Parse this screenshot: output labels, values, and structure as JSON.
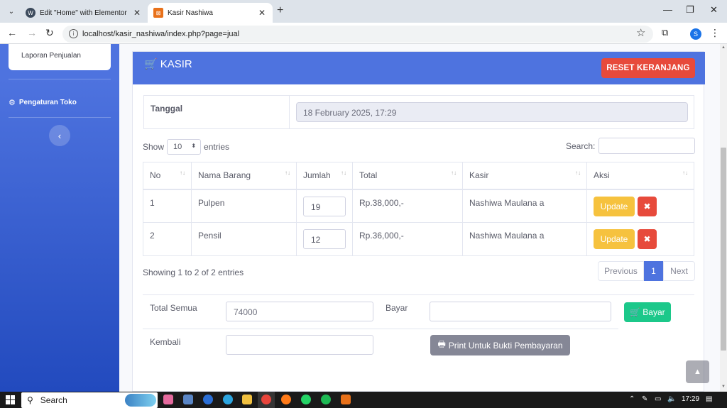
{
  "browser": {
    "tabs": [
      {
        "title": "Edit \"Home\" with Elementor",
        "icon": "wordpress-icon"
      },
      {
        "title": "Kasir Nashiwa",
        "icon": "xampp-icon"
      }
    ],
    "url": "localhost/kasir_nashiwa/index.php?page=jual",
    "profile_initial": "S"
  },
  "sidebar": {
    "card_item": "Laporan Penjualan",
    "settings_item": "Pengaturan Toko",
    "toggle_glyph": "‹"
  },
  "kasir": {
    "title": "KASIR",
    "reset_button": "RESET KERANJANG",
    "tanggal_label": "Tanggal",
    "tanggal_value": "18 February 2025, 17:29",
    "show_label": "Show",
    "entries_value": "10",
    "entries_label": "entries",
    "search_label": "Search:",
    "columns": [
      "No",
      "Nama Barang",
      "Jumlah",
      "Total",
      "Kasir",
      "Aksi"
    ],
    "rows": [
      {
        "no": "1",
        "nama": "Pulpen",
        "jumlah": "19",
        "total": "Rp.38,000,-",
        "kasir": "Nashiwa Maulana a"
      },
      {
        "no": "2",
        "nama": "Pensil",
        "jumlah": "12",
        "total": "Rp.36,000,-",
        "kasir": "Nashiwa Maulana a"
      }
    ],
    "update_label": "Update",
    "delete_glyph": "✖",
    "info": "Showing 1 to 2 of 2 entries",
    "pager": {
      "prev": "Previous",
      "current": "1",
      "next": "Next"
    },
    "total_semua_label": "Total Semua",
    "total_semua_value": "74000",
    "bayar_label": "Bayar",
    "bayar_button": "Bayar",
    "kembali_label": "Kembali",
    "print_button": "Print Untuk Bukti Pembayaran"
  },
  "taskbar": {
    "search_label": "Search",
    "clock": "17:29"
  },
  "colors": {
    "primary": "#4e73df",
    "danger": "#e74a3b",
    "warning": "#f6c23e",
    "success": "#1cc88a",
    "secondary": "#858796"
  }
}
